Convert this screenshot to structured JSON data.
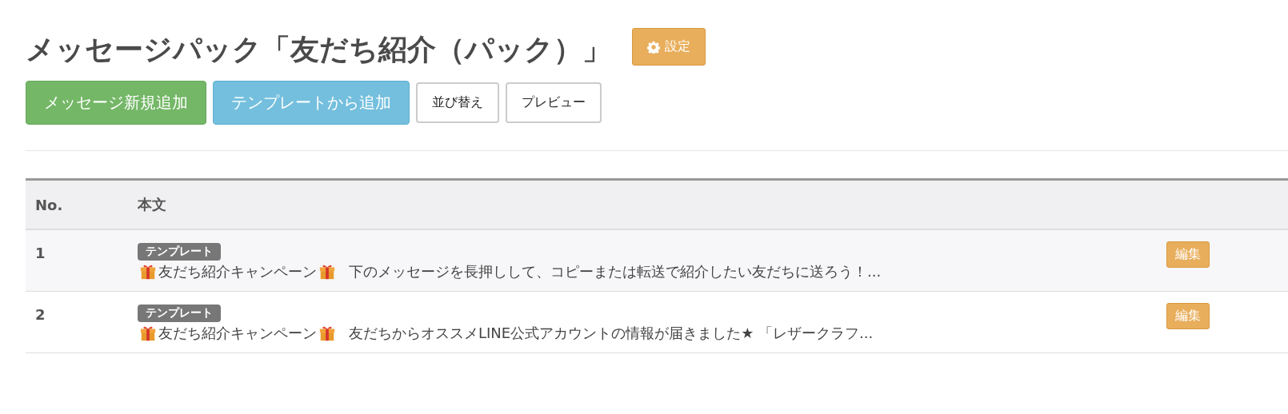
{
  "title": "メッセージパック「友だち紹介（パック）」",
  "settings_button": "設定",
  "buttons": [
    {
      "label": "メッセージ新規追加",
      "kind": "success"
    },
    {
      "label": "テンプレートから追加",
      "kind": "info"
    },
    {
      "label": "並び替え",
      "kind": "default"
    },
    {
      "label": "プレビュー",
      "kind": "default"
    }
  ],
  "table": {
    "columns": [
      "No.",
      "本文"
    ],
    "rows": [
      {
        "no": "1",
        "tag": "テンプレート",
        "campaign": "友だち紹介キャンペーン",
        "text": "下のメッセージを長押しして、コピーまたは転送で紹介したい友だちに送ろう！...",
        "action": "編集"
      },
      {
        "no": "2",
        "tag": "テンプレート",
        "campaign": "友だち紹介キャンペーン",
        "text": "友だちからオススメLINE公式アカウントの情報が届きました★ 「レザークラフ...",
        "action": "編集"
      }
    ]
  }
}
